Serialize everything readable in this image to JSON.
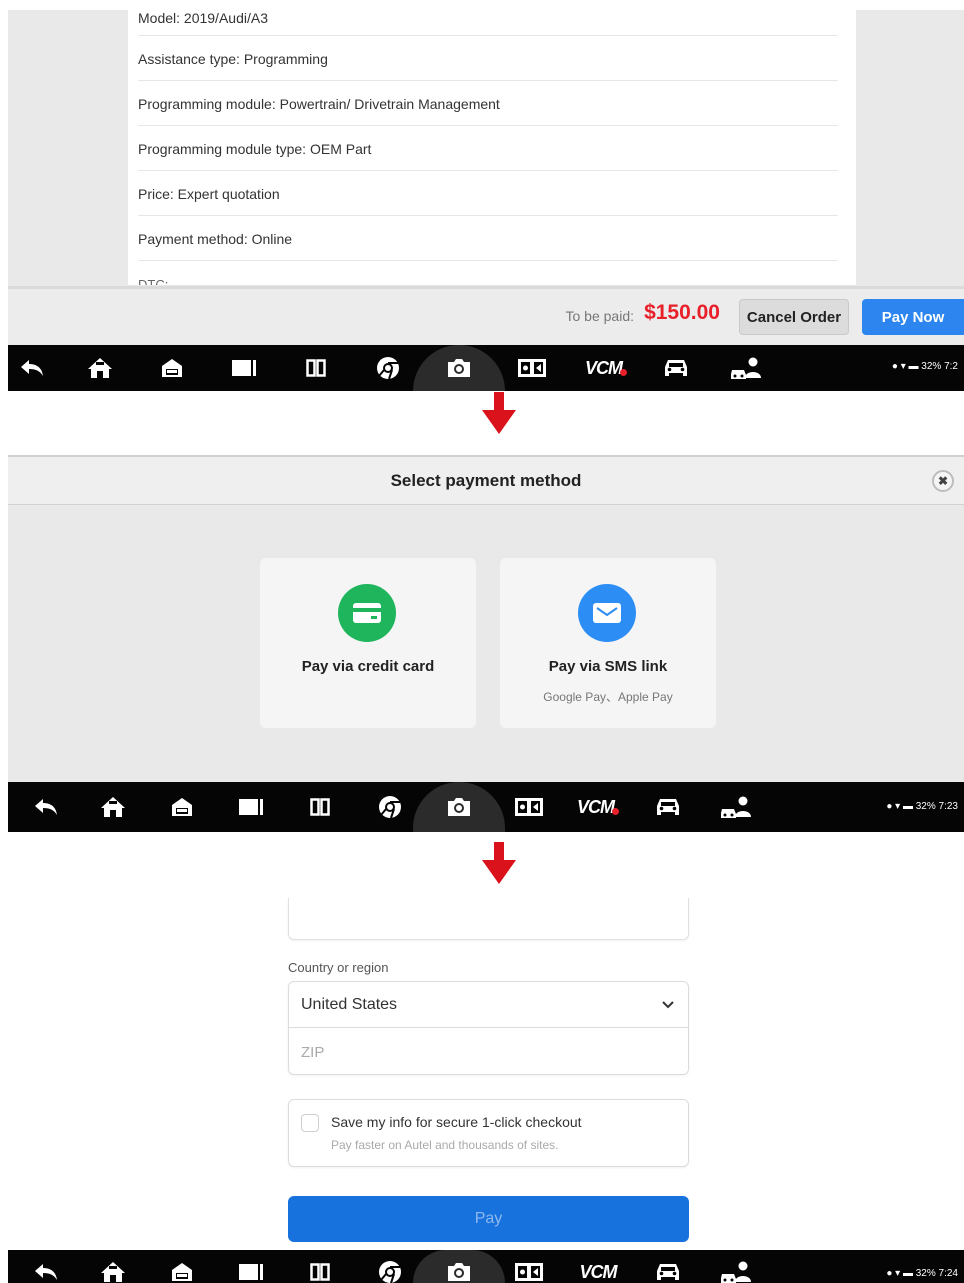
{
  "order": {
    "rows": [
      {
        "text": "Model: 2019/Audi/A3"
      },
      {
        "text": "Assistance type: Programming"
      },
      {
        "text": "Programming module: Powertrain/ Drivetrain Management"
      },
      {
        "text": "Programming module type: OEM Part"
      },
      {
        "text": "Price: Expert quotation"
      },
      {
        "text": "Payment method: Online"
      },
      {
        "text": "DTC:"
      }
    ]
  },
  "pay_bar": {
    "to_be_paid_label": "To be paid:",
    "amount": "$150.00",
    "cancel_label": "Cancel Order",
    "pay_now_label": "Pay Now"
  },
  "navbars": [
    {
      "vcm": "VCM",
      "status": "32% 7:2"
    },
    {
      "vcm": "VCM",
      "status": "32% 7:23"
    },
    {
      "vcm": "VCM",
      "status": "32% 7:24"
    }
  ],
  "payment_modal": {
    "title": "Select payment method",
    "methods": [
      {
        "label": "Pay via credit card",
        "sub": "",
        "icon": "credit-card-icon",
        "color": "#1fb55c"
      },
      {
        "label": "Pay via SMS link",
        "sub": "Google Pay、Apple Pay",
        "icon": "envelope-icon",
        "color": "#2c8ef5"
      }
    ]
  },
  "checkout": {
    "country_label": "Country or region",
    "country_value": "United States",
    "zip_placeholder": "ZIP",
    "save_title": "Save my info for secure 1-click checkout",
    "save_sub": "Pay faster on Autel and thousands of sites.",
    "pay_label": "Pay"
  },
  "colors": {
    "amount": "#e8202a",
    "pay_now": "#2d86f0",
    "pay_button": "#1872de",
    "arrow": "#d9121b"
  }
}
